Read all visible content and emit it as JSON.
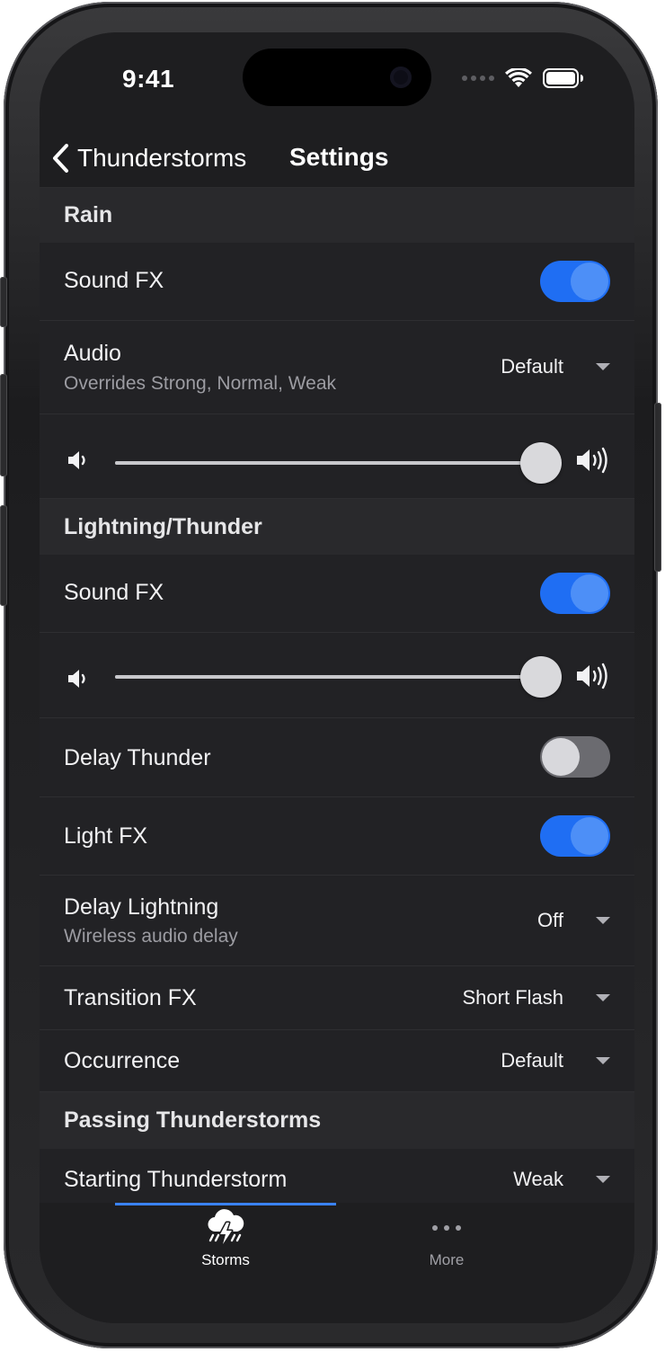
{
  "status_bar": {
    "time": "9:41",
    "icons": [
      "cellular-dots-icon",
      "wifi-icon",
      "battery-icon"
    ]
  },
  "nav": {
    "back_label": "Thunderstorms",
    "title": "Settings"
  },
  "sections": {
    "rain": {
      "header": "Rain",
      "sound_fx": {
        "label": "Sound FX",
        "state": "on"
      },
      "audio": {
        "label": "Audio",
        "sublabel": "Overrides Strong, Normal, Weak",
        "value": "Default"
      },
      "volume": {
        "level": 1.0
      }
    },
    "lightning": {
      "header": "Lightning/Thunder",
      "sound_fx": {
        "label": "Sound FX",
        "state": "on"
      },
      "volume": {
        "level": 1.0
      },
      "delay_thunder": {
        "label": "Delay Thunder",
        "state": "off"
      },
      "light_fx": {
        "label": "Light FX",
        "state": "on"
      },
      "delay_lightning": {
        "label": "Delay Lightning",
        "sublabel": "Wireless audio delay",
        "value": "Off"
      },
      "transition_fx": {
        "label": "Transition FX",
        "value": "Short Flash"
      },
      "occurrence": {
        "label": "Occurrence",
        "value": "Default"
      }
    },
    "passing": {
      "header": "Passing Thunderstorms",
      "starting": {
        "label": "Starting Thunderstorm",
        "value": "Weak"
      }
    }
  },
  "tabs": [
    {
      "label": "Storms",
      "icon": "storm-cloud-icon",
      "selected": true
    },
    {
      "label": "More",
      "icon": "more-dots-icon",
      "selected": false
    }
  ],
  "colors": {
    "accent": "#1f6ef3",
    "background": "#1e1e20",
    "row": "#222225",
    "section": "#29292c"
  }
}
